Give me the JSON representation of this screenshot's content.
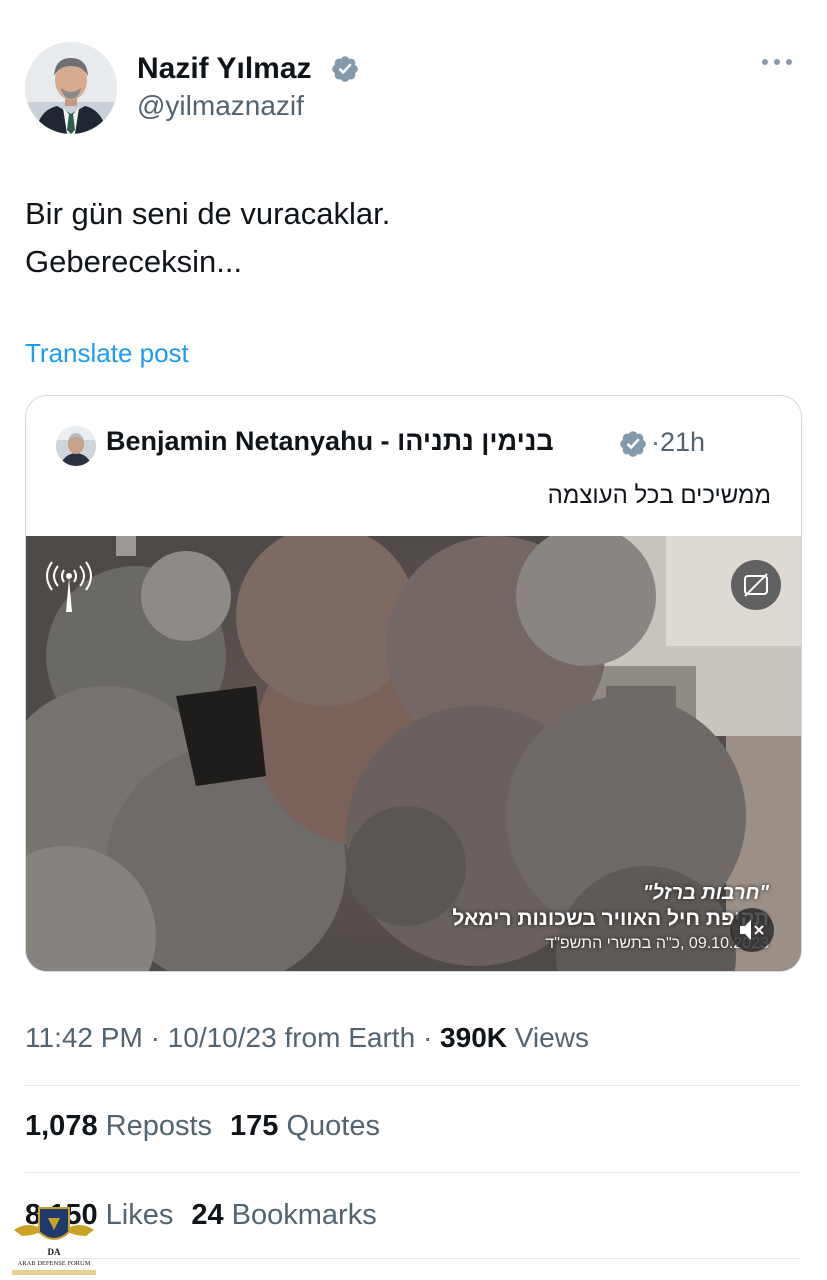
{
  "author": {
    "name": "Nazif Yılmaz",
    "handle": "@yilmaznazif"
  },
  "tweet": {
    "lines": [
      "Bir gün seni de vuracaklar.",
      "Gebereceksin..."
    ],
    "translate_label": "Translate post"
  },
  "quoted": {
    "name": "Benjamin Netanyahu - בנימין נתניהו",
    "separator": "·",
    "time": "21h",
    "text": "ממשיכים בכל העוצמה",
    "caption": {
      "line1": "\"חרבות ברזל\"",
      "line2": "תקיפת חיל האוויר בשכונות רימאל",
      "line3": "09.10.2023 ,כ\"ה בתשרי התשפ\"ד"
    }
  },
  "meta": {
    "time": "11:42 PM",
    "sep1": "·",
    "date": "10/10/23",
    "source": "from Earth",
    "sep2": "·",
    "views_count": "390K",
    "views_label": "Views"
  },
  "stats": {
    "reposts_count": "1,078",
    "reposts_label": "Reposts",
    "quotes_count": "175",
    "quotes_label": "Quotes",
    "likes_count": "8,150",
    "likes_label": "Likes",
    "bookmarks_count": "24",
    "bookmarks_label": "Bookmarks"
  },
  "watermark": {
    "initials": "DA",
    "name": "ARAB DEFENSE FORUM"
  },
  "colors": {
    "link": "#1d9bf0",
    "verified": "#829aab",
    "secondary_text": "#536471",
    "primary_text": "#0f1419"
  }
}
